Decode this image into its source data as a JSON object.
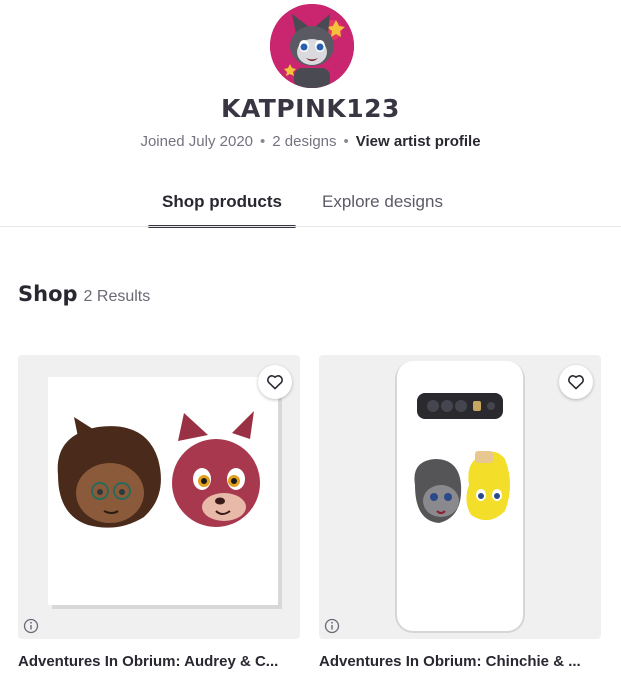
{
  "profile": {
    "artist_name": "KATPINK123",
    "joined": "Joined July 2020",
    "designs": "2 designs",
    "view_profile_link": "View artist profile",
    "avatar_icon": "cat-avatar-icon"
  },
  "tabs": [
    {
      "label": "Shop products",
      "active": true
    },
    {
      "label": "Explore designs",
      "active": false
    }
  ],
  "shop": {
    "title": "Shop",
    "results": "2 Results"
  },
  "products": [
    {
      "title": "Adventures In Obrium: Audrey & C...",
      "type": "art-print",
      "favorite_icon": "heart-outline-icon",
      "info_icon": "info-circle-icon"
    },
    {
      "title": "Adventures In Obrium: Chinchie & ...",
      "type": "phone-case",
      "favorite_icon": "heart-outline-icon",
      "info_icon": "info-circle-icon"
    }
  ],
  "colors": {
    "accent": "#3a3543",
    "avatar_bg": "#c9266f",
    "card_bg": "#f0f0f1"
  }
}
